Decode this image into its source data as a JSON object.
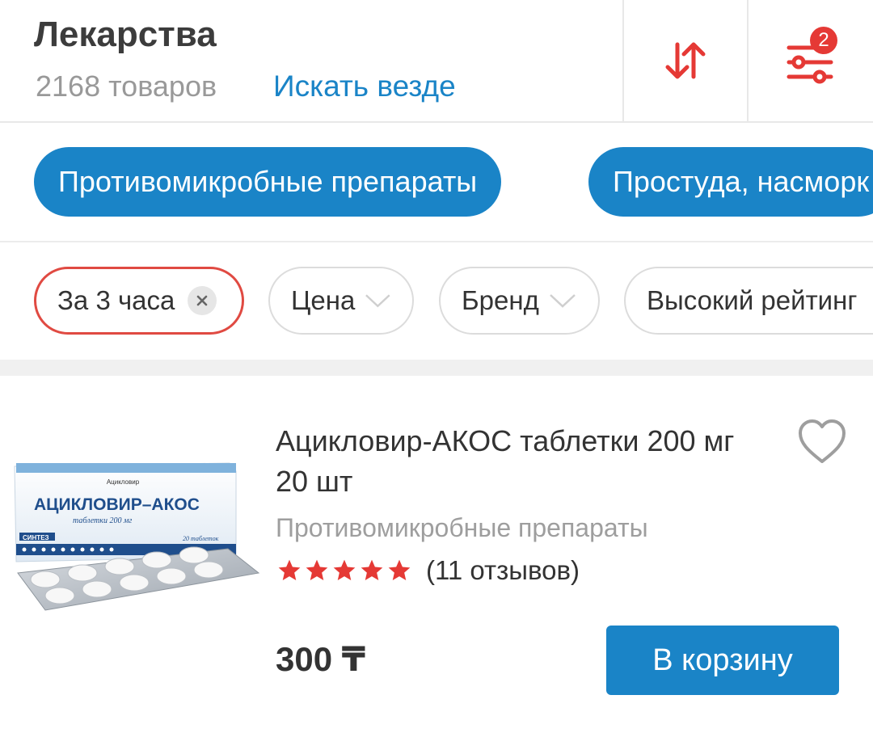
{
  "header": {
    "title": "Лекарства",
    "count": "2168 товаров",
    "search_all": "Искать везде",
    "filter_badge": "2",
    "sort_icon": "sort-arrows-icon",
    "filter_icon": "filter-sliders-icon"
  },
  "categories": [
    {
      "label": "Противомикробные препараты"
    },
    {
      "label": "Простуда, насморк"
    }
  ],
  "filters": {
    "active": {
      "label": "За 3 часа"
    },
    "price": {
      "label": "Цена"
    },
    "brand": {
      "label": "Бренд"
    },
    "rating": {
      "label": "Высокий рейтинг"
    }
  },
  "product": {
    "name": "Ацикловир-АКОС таблетки 200 мг 20 шт",
    "category": "Противомикробные препараты",
    "rating_stars": 5,
    "reviews": "(11 отзывов)",
    "price": "300 ₸",
    "cart_label": "В корзину",
    "box": {
      "top_text": "Ацикловир",
      "brand": "АЦИКЛОВИР–АКОС",
      "subtitle": "таблетки 200 мг",
      "maker": "СИНТЕЗ",
      "qty": "20 таблеток"
    }
  },
  "colors": {
    "accent": "#1a84c7",
    "red": "#e53935",
    "star": "#e53935"
  }
}
